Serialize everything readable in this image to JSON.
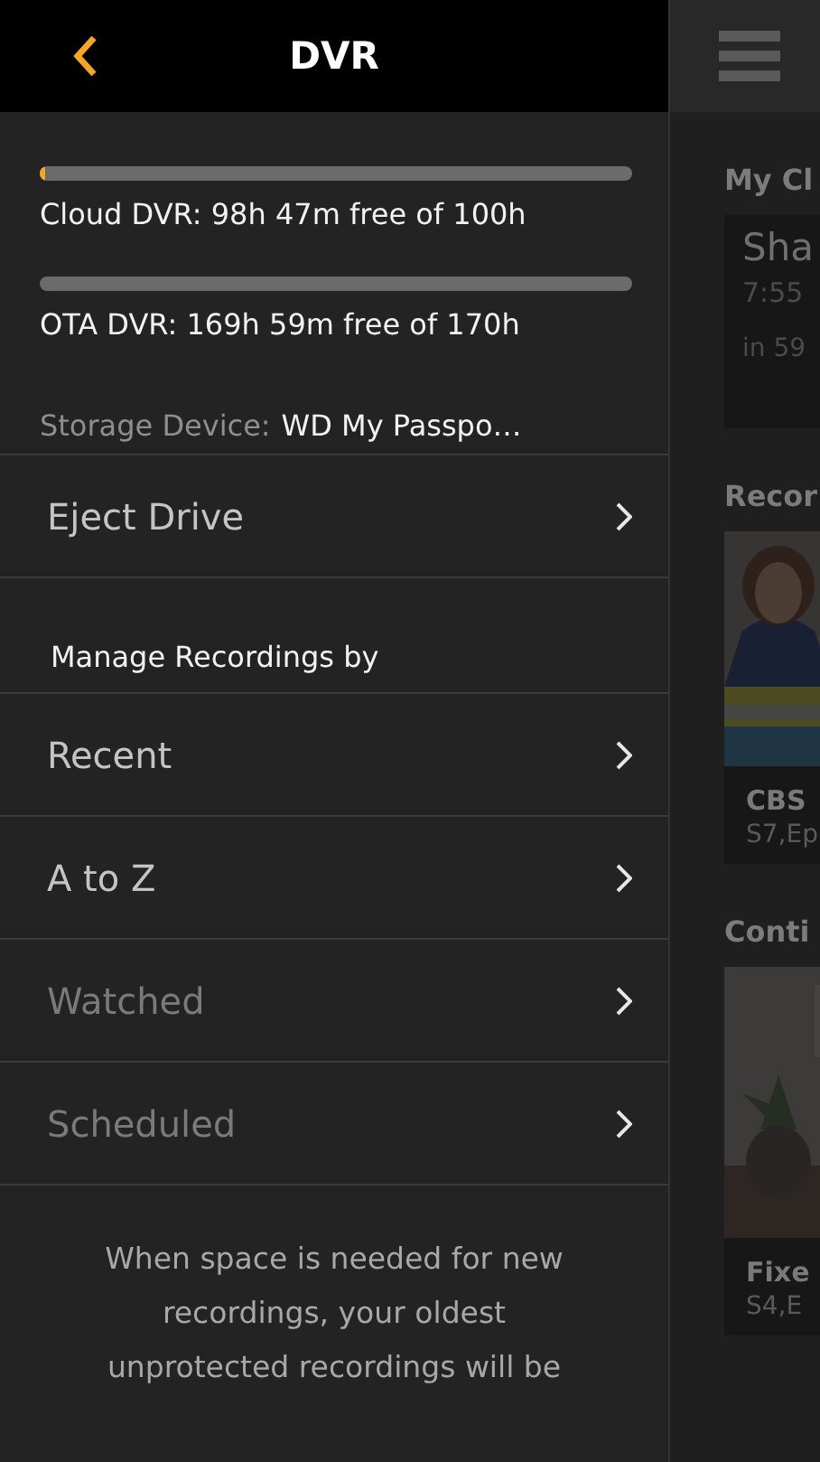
{
  "header": {
    "title": "DVR"
  },
  "storage": [
    {
      "label": "Cloud DVR: 98h 47m free of 100h",
      "level": 0.01
    },
    {
      "label": "OTA DVR: 169h 59m free of 170h",
      "level": 0
    }
  ],
  "storage_device": {
    "label": "Storage Device:",
    "value": "WD My Passpo…"
  },
  "eject": {
    "label": "Eject Drive"
  },
  "manage_heading": "Manage Recordings by",
  "sort_options": [
    {
      "label": "Recent",
      "disabled": false
    },
    {
      "label": "A to Z",
      "disabled": false
    },
    {
      "label": "Watched",
      "disabled": true
    },
    {
      "label": "Scheduled",
      "disabled": true
    }
  ],
  "note": "When space is needed for new recordings, your oldest unprotected recordings will be",
  "background": {
    "sections": [
      {
        "title": "My Cl",
        "kind": "schedule",
        "card": {
          "title": "Sha",
          "time": "7:55",
          "countdown": "in 59"
        }
      },
      {
        "title": "Recor",
        "kind": "picture",
        "card": {
          "title": "CBS",
          "subtitle": "S7,Ep"
        }
      },
      {
        "title": "Conti",
        "kind": "picture",
        "card": {
          "title": "Fixe",
          "subtitle": "S4,E"
        }
      }
    ]
  }
}
